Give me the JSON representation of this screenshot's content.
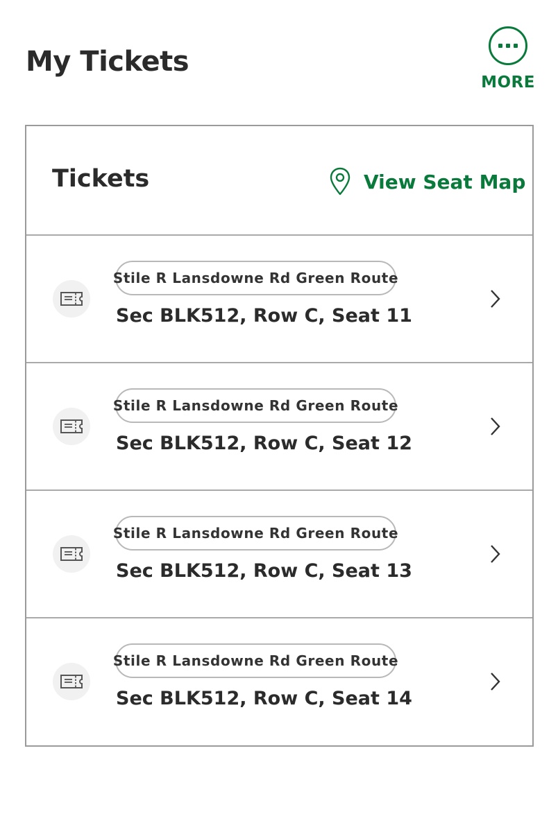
{
  "header": {
    "title": "My Tickets",
    "more_label": "MORE",
    "more_icon": "ellipsis-circle-icon"
  },
  "card": {
    "title": "Tickets",
    "seat_map_label": "View Seat Map",
    "seat_map_icon": "location-pin-icon"
  },
  "tickets": [
    {
      "route": "Stile R Lansdowne Rd Green Route",
      "seat": "Sec BLK512, Row C, Seat 11"
    },
    {
      "route": "Stile R Lansdowne Rd Green Route",
      "seat": "Sec BLK512, Row C, Seat 12"
    },
    {
      "route": "Stile R Lansdowne Rd Green Route",
      "seat": "Sec BLK512, Row C, Seat 13"
    },
    {
      "route": "Stile R Lansdowne Rd Green Route",
      "seat": "Sec BLK512, Row C, Seat 14"
    }
  ],
  "colors": {
    "accent": "#0a7a3c",
    "text": "#2b2b2b",
    "border": "#9a9a9a"
  }
}
